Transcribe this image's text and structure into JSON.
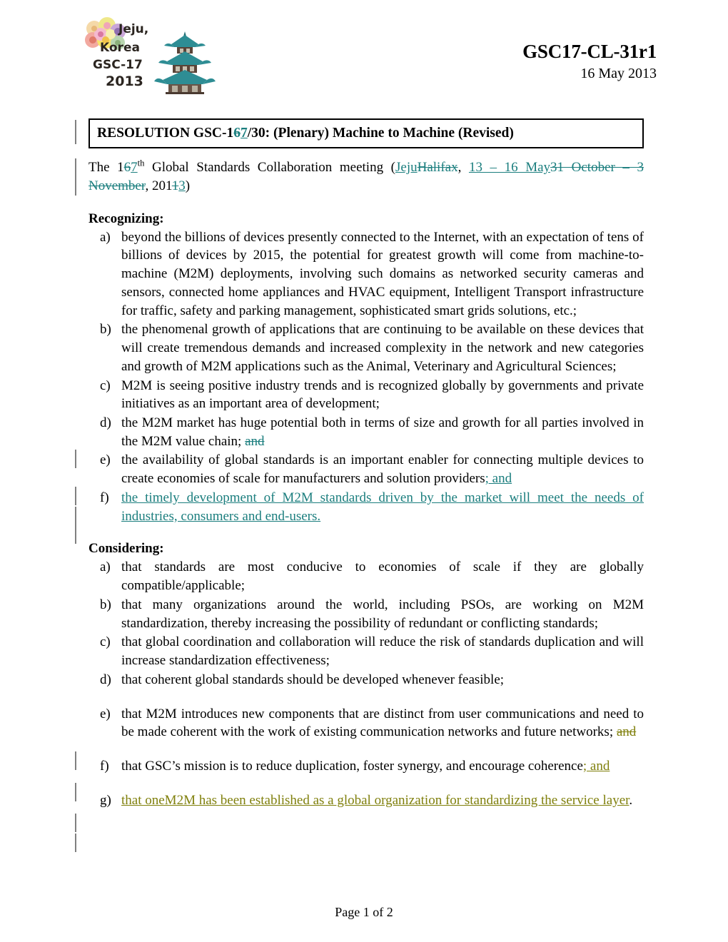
{
  "document": {
    "doc_id": "GSC17-CL-31r1",
    "date": "16 May 2013",
    "footer": "Page 1 of 2"
  },
  "logo": {
    "alt": "Jeju, Korea GSC-17 2013 logo with pagoda",
    "line1": "Jeju,",
    "line2": "Korea",
    "line3": "GSC-17",
    "line4": "2013"
  },
  "title": {
    "prefix": "RESOLUTION GSC-1",
    "deleted_num": "6",
    "inserted_num": "7",
    "suffix": "/30:  (Plenary) Machine to Machine (Revised)"
  },
  "intro": {
    "t1": "The 1",
    "del1": "6",
    "ins1": "7",
    "t2": "th",
    "t3": " Global Standards Collaboration meeting (",
    "ins2": "Jeju",
    "del2": "Halifax",
    "t4": ", ",
    "ins3": "13 – 16 May",
    "del3": "31 October – 3 November",
    "t5": ", 201",
    "del4": "1",
    "ins4": "3",
    "t6": ")"
  },
  "recognizing": {
    "heading": "Recognizing:",
    "items": [
      {
        "marker": "a)",
        "text": "beyond the billions of devices presently connected to the Internet, with an expectation of tens of billions of devices by 2015, the potential for greatest growth will come from machine-to-machine (M2M) deployments, involving such domains as networked security cameras and sensors, connected home appliances and HVAC equipment, Intelligent Transport infrastructure for traffic, safety and parking management, sophisticated smart grids solutions, etc.;"
      },
      {
        "marker": "b)",
        "text": "the phenomenal growth of applications that are continuing to be available on these devices that will create tremendous demands and increased complexity in the network and new categories and growth of M2M applications such as the Animal, Veterinary and Agricultural Sciences;"
      },
      {
        "marker": "c)",
        "text": "M2M is seeing positive industry trends and is recognized globally by governments and private initiatives as an important area of development;"
      },
      {
        "marker": "d)",
        "text": "the M2M market has huge potential both in terms of size and growth for all parties involved in the M2M value chain; ",
        "deleted_teal": "and"
      },
      {
        "marker": "e)",
        "text": "the availability of global standards is an important enabler for connecting multiple devices to create economies of scale for manufacturers and solution providers",
        "inserted_teal": "; and"
      },
      {
        "marker": "f)",
        "inserted_teal_full": "the timely development of M2M standards driven by the market will meet the needs of industries, consumers and end-users."
      }
    ]
  },
  "considering": {
    "heading": "Considering:",
    "items": [
      {
        "marker": "a)",
        "text": "that standards are most conducive to economies of scale if they are globally compatible/applicable;"
      },
      {
        "marker": "b)",
        "text": "that many organizations around the world, including PSOs, are working on M2M standardization, thereby increasing the possibility of redundant or conflicting standards;"
      },
      {
        "marker": "c)",
        "text": "that global coordination and collaboration will reduce the risk of standards duplication and will increase standardization effectiveness;"
      },
      {
        "marker": "d)",
        "text": "that coherent global standards should be developed whenever feasible;"
      },
      {
        "marker": "e)",
        "text": "that M2M introduces new components that are distinct from user communications and need to be made coherent with the work of existing communication networks and future networks; ",
        "deleted_olive": "and"
      },
      {
        "marker": "f)",
        "text": "that GSC’s mission is to reduce duplication, foster synergy, and encourage coherence",
        "inserted_olive": "; and"
      },
      {
        "marker": "g)",
        "inserted_olive_full": "that oneM2M has been established as a global organization for standardizing the service",
        "inserted_olive_full2": " layer",
        "trailing": "."
      }
    ]
  },
  "colors": {
    "insertion_author_1": "#1b7e7e",
    "insertion_author_2": "#80800d",
    "changebar": "#808080",
    "text": "#000000"
  }
}
